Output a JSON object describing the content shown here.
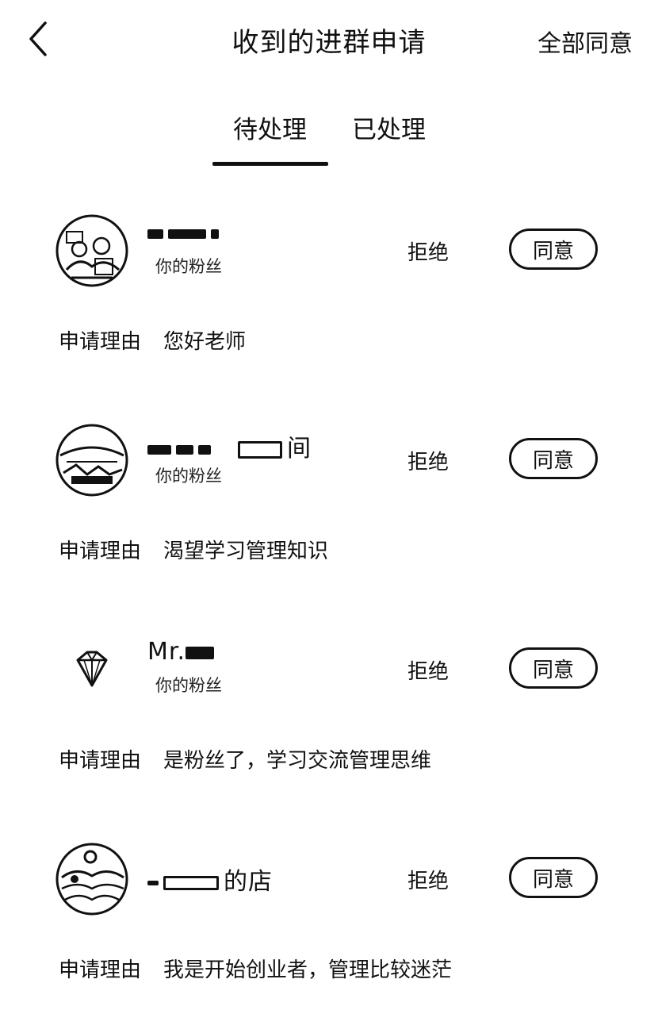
{
  "header": {
    "title": "收到的进群申请",
    "accept_all": "全部同意"
  },
  "tabs": [
    {
      "label": "待处理",
      "active": true
    },
    {
      "label": "已处理",
      "active": false
    }
  ],
  "requests": [
    {
      "name": "",
      "tag": "你的粉丝",
      "reject": "拒绝",
      "agree": "同意",
      "reason_label": "申请理由",
      "reason": "您好老师",
      "avatar": "photo-avatar-icon"
    },
    {
      "name": "间",
      "tag": "你的粉丝",
      "reject": "拒绝",
      "agree": "同意",
      "reason_label": "申请理由",
      "reason": "渴望学习管理知识",
      "avatar": "photo-avatar-icon"
    },
    {
      "name": "Mr.",
      "tag": "你的粉丝",
      "reject": "拒绝",
      "agree": "同意",
      "reason_label": "申请理由",
      "reason": "是粉丝了，学习交流管理思维",
      "avatar": "diamond-icon"
    },
    {
      "name": "的店",
      "tag": "",
      "reject": "拒绝",
      "agree": "同意",
      "reason_label": "申请理由",
      "reason": "我是开始创业者，管理比较迷茫",
      "avatar": "photo-avatar-icon"
    }
  ],
  "colors": {
    "text": "#111111",
    "background": "#ffffff"
  }
}
